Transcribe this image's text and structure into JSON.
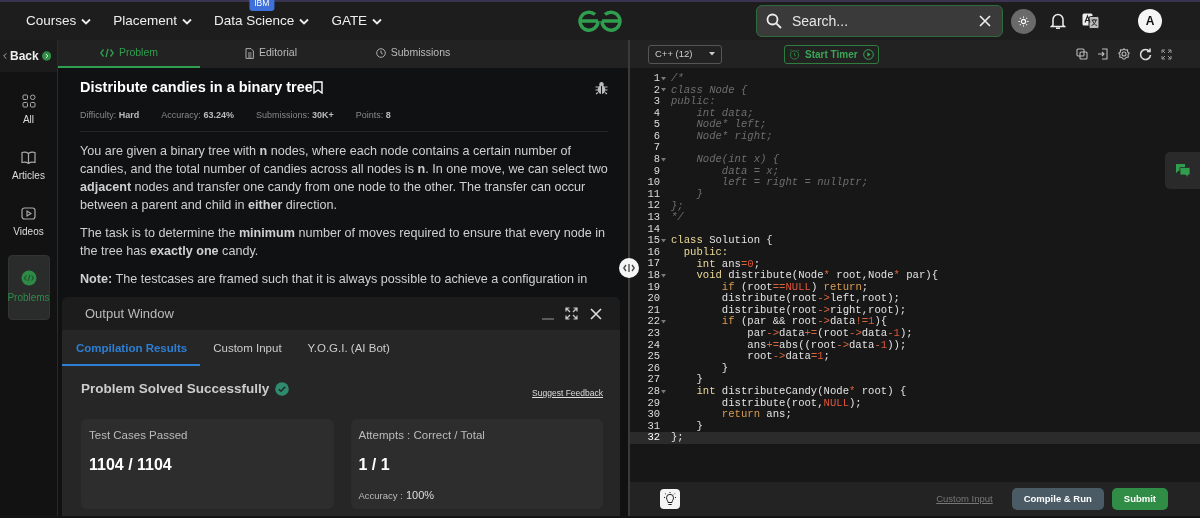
{
  "navbar": {
    "menus": [
      {
        "label": "Courses"
      },
      {
        "label": "Placement"
      },
      {
        "label": "Data Science",
        "badge": "IBM"
      },
      {
        "label": "GATE"
      }
    ],
    "search": {
      "placeholder": "Search..."
    },
    "avatar": "A"
  },
  "sidebar": {
    "back": "Back",
    "items": [
      {
        "label": "All",
        "selected": false
      },
      {
        "label": "Articles",
        "selected": false
      },
      {
        "label": "Videos",
        "selected": false
      },
      {
        "label": "Problems",
        "selected": true
      }
    ]
  },
  "problem_tabs": [
    {
      "label": "Problem",
      "selected": true
    },
    {
      "label": "Editorial",
      "selected": false
    },
    {
      "label": "Submissions",
      "selected": false
    }
  ],
  "problem": {
    "title": "Distribute candies in a binary tree",
    "meta": [
      "Difficulty: **Hard**",
      "Accuracy: **63.24%**",
      "Submissions: **30K+**",
      "Points: **8**"
    ],
    "paragraphs": [
      "You are given a binary tree with **n** nodes, where each node contains a certain number of candies, and the total number of candies across all nodes is **n**. In one move, we can select two **adjacent** nodes and transfer one candy from one node to the other. The transfer can occur between a parent and child in **either** direction.",
      "The task is to determine the **minimum** number of moves required to ensure that every node in the tree has **exactly one** candy.",
      "**Note:** The testcases are framed such that it is always possible to achieve a configuration in"
    ]
  },
  "output_window": {
    "title": "Output Window",
    "tabs": [
      {
        "label": "Compilation Results",
        "selected": true
      },
      {
        "label": "Custom Input",
        "selected": false
      },
      {
        "label": "Y.O.G.I. (AI Bot)",
        "selected": false
      }
    ],
    "status": "Problem Solved Successfully",
    "feedback_link": "Suggest Feedback",
    "cards": [
      {
        "label": "Test Cases Passed",
        "value": "1104 / 1104"
      },
      {
        "label": "Attempts : Correct / Total",
        "value": "1 / 1",
        "accuracy_label": "Accuracy :",
        "accuracy": "100%"
      }
    ]
  },
  "editor": {
    "language": "C++ (12)",
    "timer_button": "Start Timer",
    "lines": [
      {
        "number": "1",
        "fold": true,
        "active": false,
        "tokens": [
          {
            "kind": "comment",
            "text": "/*"
          }
        ]
      },
      {
        "number": "2",
        "fold": true,
        "active": false,
        "tokens": [
          {
            "kind": "comment",
            "text": "class Node {"
          }
        ]
      },
      {
        "number": "3",
        "fold": false,
        "active": false,
        "tokens": [
          {
            "kind": "comment",
            "text": "public:"
          }
        ]
      },
      {
        "number": "4",
        "fold": false,
        "active": false,
        "tokens": [
          {
            "kind": "comment",
            "text": "    int data;"
          }
        ]
      },
      {
        "number": "5",
        "fold": false,
        "active": false,
        "tokens": [
          {
            "kind": "comment",
            "text": "    Node* left;"
          }
        ]
      },
      {
        "number": "6",
        "fold": false,
        "active": false,
        "tokens": [
          {
            "kind": "comment",
            "text": "    Node* right;"
          }
        ]
      },
      {
        "number": "7",
        "fold": false,
        "active": false
      },
      {
        "number": "8",
        "fold": true,
        "active": false,
        "tokens": [
          {
            "kind": "comment",
            "text": "    Node(int x) {"
          }
        ]
      },
      {
        "number": "9",
        "fold": false,
        "active": false,
        "tokens": [
          {
            "kind": "comment",
            "text": "        data = x;"
          }
        ]
      },
      {
        "number": "10",
        "fold": false,
        "active": false,
        "tokens": [
          {
            "kind": "comment",
            "text": "        left = right = nullptr;"
          }
        ]
      },
      {
        "number": "11",
        "fold": false,
        "active": false,
        "tokens": [
          {
            "kind": "comment",
            "text": "    }"
          }
        ]
      },
      {
        "number": "12",
        "fold": false,
        "active": false,
        "tokens": [
          {
            "kind": "comment",
            "text": "};"
          }
        ]
      },
      {
        "number": "13",
        "fold": false,
        "active": false,
        "tokens": [
          {
            "kind": "comment",
            "text": "*/"
          }
        ]
      },
      {
        "number": "14",
        "fold": false,
        "active": false
      },
      {
        "number": "15",
        "fold": true,
        "active": false,
        "tokens": [
          {
            "kind": "keyword",
            "text": "class"
          },
          {
            "kind": "plain",
            "text": " Solution {"
          }
        ]
      },
      {
        "number": "16",
        "fold": false,
        "active": false,
        "tokens": [
          {
            "kind": "keyword",
            "text": "  public:"
          }
        ]
      },
      {
        "number": "17",
        "fold": false,
        "active": false,
        "tokens": [
          {
            "kind": "keyword",
            "text": "    int"
          },
          {
            "kind": "plain",
            "text": " ans"
          },
          {
            "kind": "operator",
            "text": "="
          },
          {
            "kind": "number",
            "text": "0"
          },
          {
            "kind": "plain",
            "text": ";"
          }
        ]
      },
      {
        "number": "18",
        "fold": true,
        "active": false,
        "tokens": [
          {
            "kind": "keyword",
            "text": "    void"
          },
          {
            "kind": "plain",
            "text": " distribute(Node"
          },
          {
            "kind": "operator",
            "text": "*"
          },
          {
            "kind": "plain",
            "text": " root,Node"
          },
          {
            "kind": "operator",
            "text": "*"
          },
          {
            "kind": "plain",
            "text": " par){"
          }
        ]
      },
      {
        "number": "19",
        "fold": false,
        "active": false,
        "tokens": [
          {
            "kind": "control",
            "text": "        if"
          },
          {
            "kind": "plain",
            "text": " (root"
          },
          {
            "kind": "operator",
            "text": "=="
          },
          {
            "kind": "number",
            "text": "NULL"
          },
          {
            "kind": "plain",
            "text": ") "
          },
          {
            "kind": "control",
            "text": "return"
          },
          {
            "kind": "plain",
            "text": ";"
          }
        ]
      },
      {
        "number": "20",
        "fold": false,
        "active": false,
        "tokens": [
          {
            "kind": "plain",
            "text": "        distribute(root"
          },
          {
            "kind": "operator",
            "text": "->"
          },
          {
            "kind": "plain",
            "text": "left,root);"
          }
        ]
      },
      {
        "number": "21",
        "fold": false,
        "active": false,
        "tokens": [
          {
            "kind": "plain",
            "text": "        distribute(root"
          },
          {
            "kind": "operator",
            "text": "->"
          },
          {
            "kind": "plain",
            "text": "right,root);"
          }
        ]
      },
      {
        "number": "22",
        "fold": true,
        "active": false,
        "tokens": [
          {
            "kind": "control",
            "text": "        if"
          },
          {
            "kind": "plain",
            "text": " (par && root"
          },
          {
            "kind": "operator",
            "text": "->"
          },
          {
            "kind": "plain",
            "text": "data"
          },
          {
            "kind": "operator",
            "text": "!="
          },
          {
            "kind": "number",
            "text": "1"
          },
          {
            "kind": "plain",
            "text": "){"
          }
        ]
      },
      {
        "number": "23",
        "fold": false,
        "active": false,
        "tokens": [
          {
            "kind": "plain",
            "text": "            par"
          },
          {
            "kind": "operator",
            "text": "->"
          },
          {
            "kind": "plain",
            "text": "data"
          },
          {
            "kind": "operator",
            "text": "+="
          },
          {
            "kind": "plain",
            "text": "(root"
          },
          {
            "kind": "operator",
            "text": "->"
          },
          {
            "kind": "plain",
            "text": "data"
          },
          {
            "kind": "operator",
            "text": "-"
          },
          {
            "kind": "number",
            "text": "1"
          },
          {
            "kind": "plain",
            "text": ");"
          }
        ]
      },
      {
        "number": "24",
        "fold": false,
        "active": false,
        "tokens": [
          {
            "kind": "plain",
            "text": "            ans"
          },
          {
            "kind": "operator",
            "text": "+="
          },
          {
            "kind": "plain",
            "text": "abs((root"
          },
          {
            "kind": "operator",
            "text": "->"
          },
          {
            "kind": "plain",
            "text": "data"
          },
          {
            "kind": "operator",
            "text": "-"
          },
          {
            "kind": "number",
            "text": "1"
          },
          {
            "kind": "plain",
            "text": "));"
          }
        ]
      },
      {
        "number": "25",
        "fold": false,
        "active": false,
        "tokens": [
          {
            "kind": "plain",
            "text": "            root"
          },
          {
            "kind": "operator",
            "text": "->"
          },
          {
            "kind": "plain",
            "text": "data"
          },
          {
            "kind": "operator",
            "text": "="
          },
          {
            "kind": "number",
            "text": "1"
          },
          {
            "kind": "plain",
            "text": ";"
          }
        ]
      },
      {
        "number": "26",
        "fold": false,
        "active": false,
        "tokens": [
          {
            "kind": "plain",
            "text": "        }"
          }
        ]
      },
      {
        "number": "27",
        "fold": false,
        "active": false,
        "tokens": [
          {
            "kind": "plain",
            "text": "    }"
          }
        ]
      },
      {
        "number": "28",
        "fold": true,
        "active": false,
        "tokens": [
          {
            "kind": "keyword",
            "text": "    int"
          },
          {
            "kind": "plain",
            "text": " distributeCandy(Node"
          },
          {
            "kind": "operator",
            "text": "*"
          },
          {
            "kind": "plain",
            "text": " root) {"
          }
        ]
      },
      {
        "number": "29",
        "fold": false,
        "active": false,
        "tokens": [
          {
            "kind": "plain",
            "text": "        distribute(root,"
          },
          {
            "kind": "number",
            "text": "NULL"
          },
          {
            "kind": "plain",
            "text": ");"
          }
        ]
      },
      {
        "number": "30",
        "fold": false,
        "active": false,
        "tokens": [
          {
            "kind": "control",
            "text": "        return"
          },
          {
            "kind": "plain",
            "text": " ans;"
          }
        ]
      },
      {
        "number": "31",
        "fold": false,
        "active": false,
        "tokens": [
          {
            "kind": "plain",
            "text": "    }"
          }
        ]
      },
      {
        "number": "32",
        "fold": false,
        "active": true,
        "tokens": [
          {
            "kind": "plain",
            "text": "};"
          }
        ]
      }
    ],
    "custom_input": "Custom Input",
    "buttons": [
      {
        "label": "Compile & Run",
        "kind": "secondary"
      },
      {
        "label": "Submit",
        "kind": "primary"
      }
    ]
  }
}
